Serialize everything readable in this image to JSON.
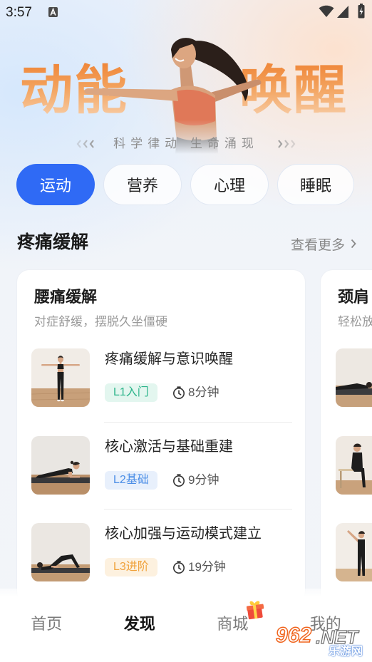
{
  "status_bar": {
    "time": "3:57",
    "icons": {
      "notification": "a-notification-icon",
      "wifi": "wifi-icon",
      "signal": "cellular-signal-icon",
      "battery": "battery-charging-icon"
    }
  },
  "hero": {
    "title_left": "动能",
    "title_right": "唤醒",
    "tagline": "科学律动 生命涌现",
    "left_decoration_icon": "triple-chevron-left-icon",
    "right_decoration_icon": "triple-chevron-right-icon"
  },
  "tabs": [
    {
      "label": "运动",
      "selected": true
    },
    {
      "label": "营养",
      "selected": false
    },
    {
      "label": "心理",
      "selected": false
    },
    {
      "label": "睡眠",
      "selected": false
    }
  ],
  "section": {
    "title": "疼痛缓解",
    "more_label": "查看更多",
    "more_icon": "chevron-right-icon"
  },
  "cards": [
    {
      "title": "腰痛缓解",
      "subtitle": "对症舒缓，摆脱久坐僵硬",
      "items": [
        {
          "title": "疼痛缓解与意识唤醒",
          "level": "L1入门",
          "level_color": "#2bb48a",
          "level_bg": "#e3f6ef",
          "duration": "8分钟",
          "duration_icon": "clock-icon"
        },
        {
          "title": "核心激活与基础重建",
          "level": "L2基础",
          "level_color": "#4a8de6",
          "level_bg": "#e8f0fc",
          "duration": "9分钟",
          "duration_icon": "clock-icon"
        },
        {
          "title": "核心加强与运动模式建立",
          "level": "L3进阶",
          "level_color": "#f0a13a",
          "level_bg": "#fdf1df",
          "duration": "19分钟",
          "duration_icon": "clock-icon"
        }
      ]
    },
    {
      "title": "颈肩",
      "subtitle": "轻松放"
    }
  ],
  "bottom_nav": {
    "items": [
      {
        "label": "首页",
        "selected": false
      },
      {
        "label": "发现",
        "selected": true
      },
      {
        "label": "商城",
        "selected": false,
        "badge_icon": "gift-icon"
      },
      {
        "label": "我的",
        "selected": false
      }
    ]
  },
  "watermark": {
    "brand_number": "962",
    "brand_suffix": ".NET",
    "site_name": "乐游网"
  },
  "colors": {
    "accent": "#2f6af5",
    "hero_title_top": "#ef8537",
    "hero_title_bottom": "#f8d0ab",
    "text_primary": "#1f1f1f",
    "text_secondary": "#9a9a9a",
    "nav_inactive": "#7a7a7a"
  }
}
